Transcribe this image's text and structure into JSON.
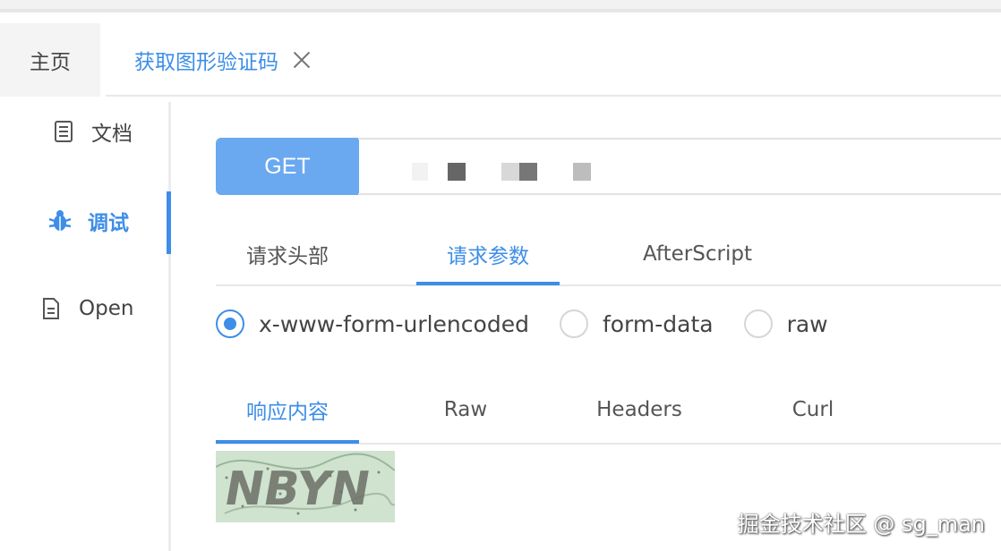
{
  "tabs": {
    "home_label": "主页",
    "active_label": "获取图形验证码"
  },
  "sidebar": {
    "items": [
      {
        "label": "文档",
        "icon": "document-icon",
        "active": false
      },
      {
        "label": "调试",
        "icon": "bug-icon",
        "active": true
      },
      {
        "label": "Open",
        "icon": "file-icon",
        "active": false
      }
    ]
  },
  "request": {
    "method": "GET"
  },
  "request_tabs": [
    {
      "label": "请求头部",
      "active": false
    },
    {
      "label": "请求参数",
      "active": true
    },
    {
      "label": "AfterScript",
      "active": false
    }
  ],
  "body_types": [
    {
      "label": "x-www-form-urlencoded",
      "checked": true
    },
    {
      "label": "form-data",
      "checked": false
    },
    {
      "label": "raw",
      "checked": false
    }
  ],
  "response_tabs": [
    {
      "label": "响应内容",
      "active": true
    },
    {
      "label": "Raw",
      "active": false
    },
    {
      "label": "Headers",
      "active": false
    },
    {
      "label": "Curl",
      "active": false
    }
  ],
  "response": {
    "captcha_text": "NBYN"
  },
  "watermark": "掘金技术社区 @ sg_man",
  "colors": {
    "accent": "#3d8ee8",
    "method_bg": "#6aa9f0"
  }
}
